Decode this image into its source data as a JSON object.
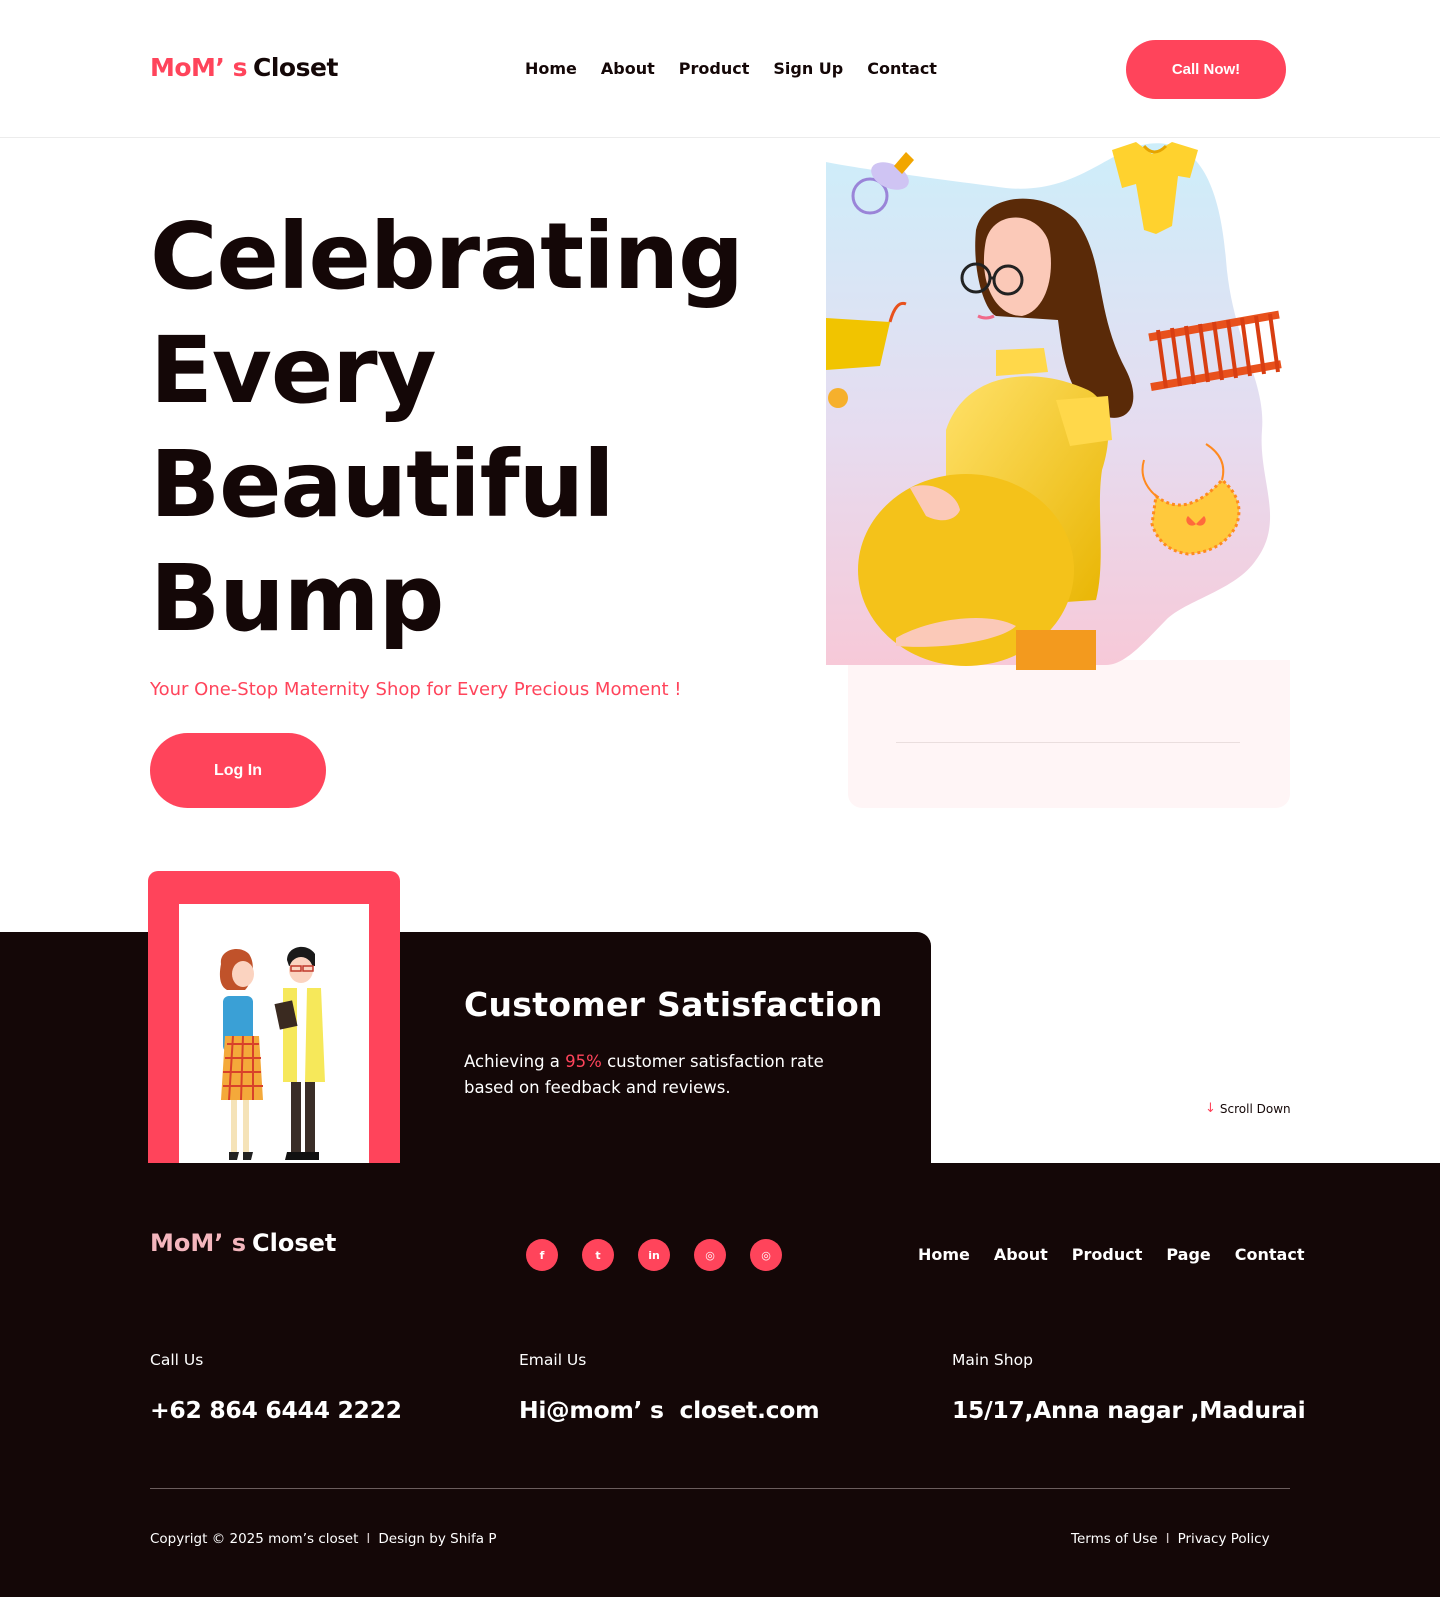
{
  "brand": {
    "name_part1": "MoM’ s",
    "name_part2": "Closet",
    "accent": "#ff445b",
    "dark": "#140707"
  },
  "nav": {
    "items": [
      "Home",
      "About",
      "Product",
      "Sign Up",
      "Contact"
    ]
  },
  "header": {
    "cta_label": "Call Now!"
  },
  "hero": {
    "title_lines": [
      "Celebrating",
      "Every",
      "Beautiful",
      "Bump"
    ],
    "tagline": "Your One-Stop Maternity Shop for Every Precious Moment !",
    "login_label": "Log In"
  },
  "satisfaction": {
    "title": "Customer Satisfaction",
    "text_before": "Achieving a ",
    "text_accent": "95%",
    "text_after": " customer satisfaction rate based on feedback and reviews."
  },
  "scroll": {
    "label": "Scroll Down",
    "arrow": "↓"
  },
  "footer": {
    "brand_part1": "MoM’ s",
    "brand_part2": "Closet",
    "socials": [
      {
        "icon": "facebook-icon",
        "glyph": "f"
      },
      {
        "icon": "twitter-icon",
        "glyph": "t"
      },
      {
        "icon": "linkedin-icon",
        "glyph": "in"
      },
      {
        "icon": "instagram-icon",
        "glyph": "◎"
      },
      {
        "icon": "instagram-icon",
        "glyph": "◎"
      }
    ],
    "nav": [
      "Home",
      "About",
      "Product",
      "Page",
      "Contact"
    ],
    "call_label": "Call Us",
    "call_value": "+62 864 6444 2222",
    "email_label": "Email Us",
    "email_value": "Hi@mom’ s  closet.com",
    "shop_label": "Main Shop",
    "shop_value": "15/17,Anna nagar ,Madurai",
    "copyright": "Copyrigt © 2025 mom’s closet",
    "design_credit": "Design by Shifa P",
    "separator": "I",
    "terms": "Terms of Use",
    "privacy": "Privacy Policy"
  }
}
